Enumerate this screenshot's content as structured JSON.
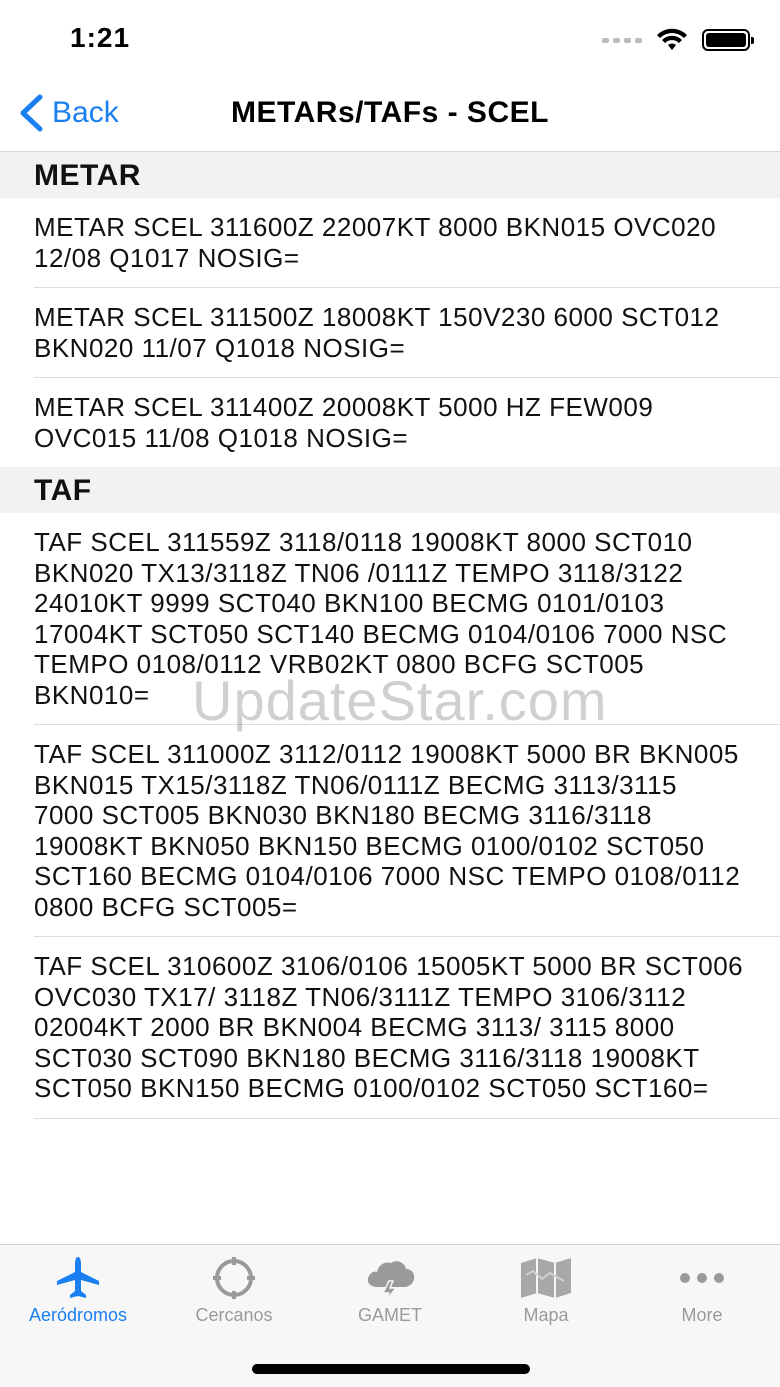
{
  "status": {
    "time": "1:21"
  },
  "nav": {
    "back_label": "Back",
    "title": "METARs/TAFs - SCEL"
  },
  "sections": {
    "metar": {
      "title": "METAR",
      "items": [
        "METAR SCEL 311600Z 22007KT 8000 BKN015 OVC020 12/08 Q1017 NOSIG=",
        "METAR SCEL 311500Z 18008KT 150V230 6000 SCT012 BKN020 11/07 Q1018 NOSIG=",
        "METAR SCEL 311400Z 20008KT 5000 HZ FEW009 OVC015 11/08 Q1018 NOSIG="
      ]
    },
    "taf": {
      "title": "TAF",
      "items": [
        "TAF SCEL 311559Z 3118/0118 19008KT 8000 SCT010 BKN020 TX13/3118Z TN06 /0111Z TEMPO 3118/3122 24010KT 9999 SCT040 BKN100 BECMG 0101/0103 17004KT SCT050 SCT140 BECMG 0104/0106 7000 NSC TEMPO 0108/0112 VRB02KT 0800 BCFG SCT005 BKN010=",
        "TAF SCEL 311000Z 3112/0112 19008KT 5000 BR BKN005 BKN015 TX15/3118Z TN06/0111Z BECMG 3113/3115 7000 SCT005 BKN030 BKN180 BECMG 3116/3118 19008KT BKN050 BKN150 BECMG 0100/0102 SCT050 SCT160 BECMG 0104/0106 7000 NSC TEMPO 0108/0112 0800 BCFG SCT005=",
        "TAF SCEL 310600Z 3106/0106 15005KT 5000 BR SCT006 OVC030 TX17/ 3118Z TN06/3111Z TEMPO 3106/3112 02004KT 2000 BR BKN004 BECMG 3113/ 3115 8000 SCT030 SCT090 BKN180 BECMG 3116/3118 19008KT SCT050 BKN150 BECMG 0100/0102 SCT050 SCT160="
      ]
    }
  },
  "watermark": "UpdateStar.com",
  "tabs": [
    {
      "label": "Aeródromos",
      "icon": "airplane-icon",
      "active": true
    },
    {
      "label": "Cercanos",
      "icon": "crosshair-icon",
      "active": false
    },
    {
      "label": "GAMET",
      "icon": "cloud-lightning-icon",
      "active": false
    },
    {
      "label": "Mapa",
      "icon": "map-icon",
      "active": false
    },
    {
      "label": "More",
      "icon": "more-icon",
      "active": false
    }
  ],
  "colors": {
    "accent": "#1a7ff0",
    "inactive": "#9a9a9a",
    "section_bg": "#f2f2f3"
  }
}
